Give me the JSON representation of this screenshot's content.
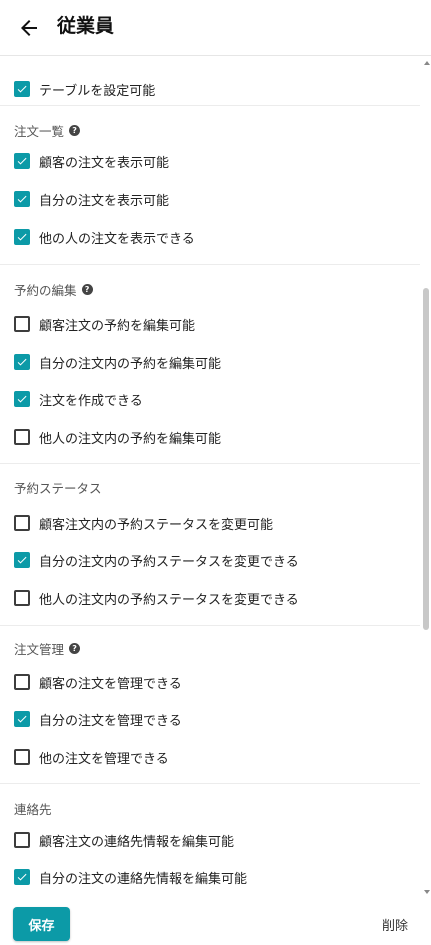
{
  "header": {
    "title": "従業員",
    "back_icon": "arrow-left-icon"
  },
  "colors": {
    "accent": "#0c9aa7",
    "checkbox_border": "#3d3d3d"
  },
  "sections": [
    {
      "title": "",
      "help": false,
      "items": [
        {
          "label": "テーブルを設定可能",
          "checked": true
        }
      ]
    },
    {
      "title": "注文一覧",
      "help": true,
      "items": [
        {
          "label": "顧客の注文を表示可能",
          "checked": true
        },
        {
          "label": "自分の注文を表示可能",
          "checked": true
        },
        {
          "label": "他の人の注文を表示できる",
          "checked": true
        }
      ]
    },
    {
      "title": "予約の編集",
      "help": true,
      "items": [
        {
          "label": "顧客注文の予約を編集可能",
          "checked": false
        },
        {
          "label": "自分の注文内の予約を編集可能",
          "checked": true
        },
        {
          "label": "注文を作成できる",
          "checked": true
        },
        {
          "label": "他人の注文内の予約を編集可能",
          "checked": false
        }
      ]
    },
    {
      "title": "予約ステータス",
      "help": false,
      "items": [
        {
          "label": "顧客注文内の予約ステータスを変更可能",
          "checked": false
        },
        {
          "label": "自分の注文内の予約ステータスを変更できる",
          "checked": true
        },
        {
          "label": "他人の注文内の予約ステータスを変更できる",
          "checked": false
        }
      ]
    },
    {
      "title": "注文管理",
      "help": true,
      "items": [
        {
          "label": "顧客の注文を管理できる",
          "checked": false
        },
        {
          "label": "自分の注文を管理できる",
          "checked": true
        },
        {
          "label": "他の注文を管理できる",
          "checked": false
        }
      ]
    },
    {
      "title": "連絡先",
      "help": false,
      "items": [
        {
          "label": "顧客注文の連絡先情報を編集可能",
          "checked": false
        },
        {
          "label": "自分の注文の連絡先情報を編集可能",
          "checked": true
        }
      ]
    }
  ],
  "footer": {
    "save_label": "保存",
    "delete_label": "削除"
  }
}
